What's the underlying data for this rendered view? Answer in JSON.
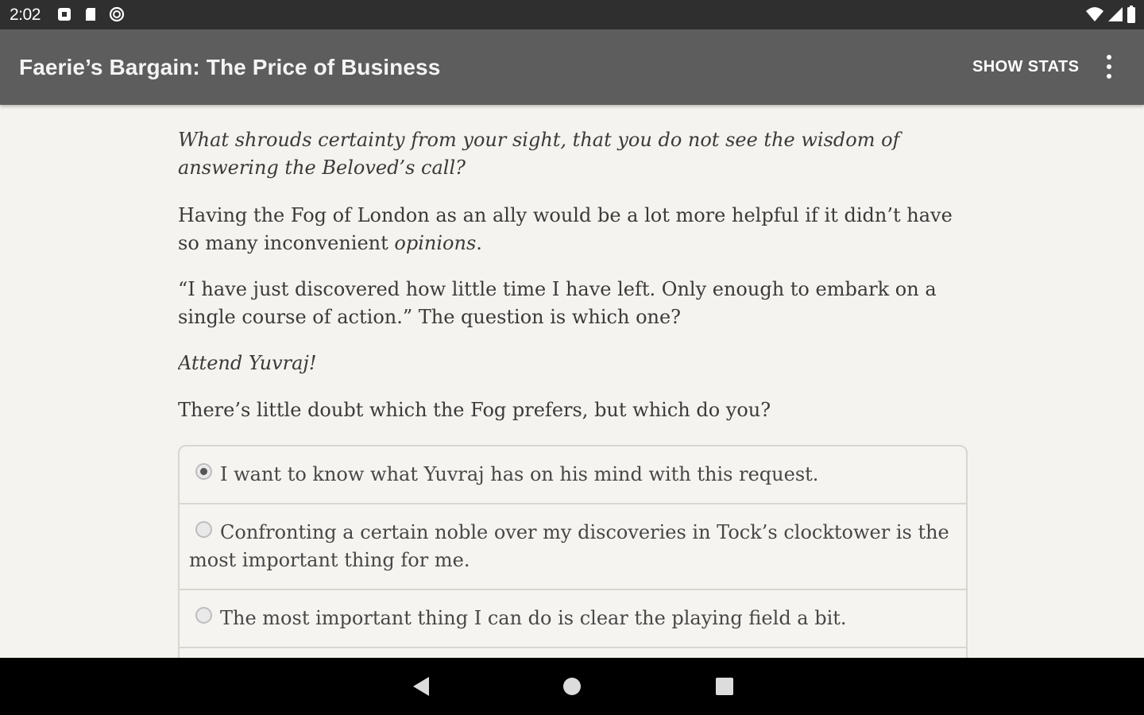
{
  "status_bar": {
    "time": "2:02",
    "icons": [
      "notification-square-icon",
      "sd-card-icon",
      "sync-icon",
      "wifi-icon",
      "signal-icon",
      "battery-icon"
    ]
  },
  "app_bar": {
    "title": "Faerie’s Bargain: The Price of Business",
    "show_stats_label": "SHOW STATS",
    "menu_icon": "more-vert-icon",
    "background": "#5d5d5d"
  },
  "story": {
    "paragraphs": [
      {
        "text": "What shrouds certainty from your sight, that you do not see the wisdom of answering the Beloved’s call?",
        "italic": true
      },
      {
        "text_before": "Having the Fog of London as an ally would be a lot more helpful if it didn’t have so many inconvenient ",
        "italic_word": "opinions",
        "text_after": "."
      },
      {
        "text": "“I have just discovered how little time I have left. Only enough to embark on a single course of action.” The question is which one?"
      },
      {
        "text": "Attend Yuvraj!",
        "italic": true
      },
      {
        "text": "There’s little doubt which the Fog prefers, but which do you?"
      }
    ]
  },
  "choices": [
    {
      "label": "I want to know what Yuvraj has on his mind with this request.",
      "selected": true
    },
    {
      "label": "Confronting a certain noble over my discoveries in Tock’s clocktower is the most important thing for me.",
      "selected": false
    },
    {
      "label": "The most important thing I can do is clear the playing field a bit.",
      "selected": false
    }
  ],
  "nav_bar": {
    "buttons": [
      "back-icon",
      "home-icon",
      "recents-icon"
    ]
  }
}
